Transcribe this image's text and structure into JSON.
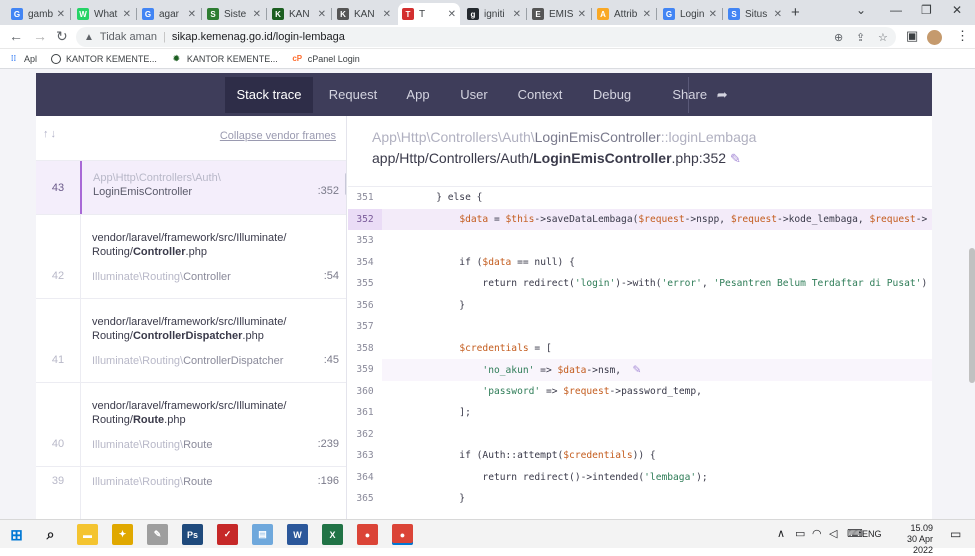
{
  "browser": {
    "tabs": [
      {
        "label": "gamb",
        "color": "#4285f4",
        "glyph": "G"
      },
      {
        "label": "What",
        "color": "#25d366",
        "glyph": "W"
      },
      {
        "label": "agar",
        "color": "#4285f4",
        "glyph": "G"
      },
      {
        "label": "Siste",
        "color": "#2e7d32",
        "glyph": "S"
      },
      {
        "label": "KAN",
        "color": "#1b5e20",
        "glyph": "K"
      },
      {
        "label": "KAN",
        "color": "#555555",
        "glyph": "K"
      },
      {
        "label": "T",
        "color": "#d32f2f",
        "glyph": "T"
      },
      {
        "label": "igniti",
        "color": "#24292e",
        "glyph": "g"
      },
      {
        "label": "EMIS",
        "color": "#555555",
        "glyph": "E"
      },
      {
        "label": "Attrib",
        "color": "#f9a825",
        "glyph": "A"
      },
      {
        "label": "Login",
        "color": "#4285f4",
        "glyph": "G"
      },
      {
        "label": "Situs",
        "color": "#4285f4",
        "glyph": "S"
      }
    ],
    "security_label": "Tidak aman",
    "url": "sikap.kemenag.go.id/login-lembaga",
    "bookmarks": [
      "Apl",
      "KANTOR KEMENTE...",
      "KANTOR KEMENTE...",
      "cPanel Login"
    ]
  },
  "ignition": {
    "tabs": [
      "Stack trace",
      "Request",
      "App",
      "User",
      "Context",
      "Debug",
      "Share"
    ],
    "active_tab": "Stack trace",
    "collapse_label": "Collapse vendor frames",
    "frames": [
      {
        "number": "43",
        "ns": "App\\Http\\Controllers\\Auth\\",
        "cls": "LoginEmisController",
        "line": ":352"
      },
      {
        "number": "42",
        "path_pre": "vendor/laravel/framework/src/Illuminate/",
        "path_mid": "Routing/",
        "path_bold": "Controller",
        "path_ext": ".php",
        "ns": "Illuminate\\Routing\\",
        "cls": "Controller",
        "line": ":54"
      },
      {
        "number": "41",
        "path_pre": "vendor/laravel/framework/src/Illuminate/",
        "path_mid": "Routing/",
        "path_bold": "ControllerDispatcher",
        "path_ext": ".php",
        "ns": "Illuminate\\Routing\\",
        "cls": "ControllerDispatcher",
        "line": ":45"
      },
      {
        "number": "40",
        "path_pre": "vendor/laravel/framework/src/Illuminate/",
        "path_mid": "Routing/",
        "path_bold": "Route",
        "path_ext": ".php",
        "ns": "Illuminate\\Routing\\",
        "cls": "Route",
        "line": ":239"
      },
      {
        "number": "39",
        "ns": "Illuminate\\Routing\\",
        "cls": "Route",
        "line": ":196"
      }
    ],
    "source": {
      "class_ns": "App\\Http\\Controllers\\Auth\\",
      "class_name": "LoginEmisController",
      "method": "::loginLembaga",
      "file_prefix": "app/Http/Controllers/Auth/",
      "file_bold": "LoginEmisController",
      "file_suffix": ".php:352"
    },
    "code": [
      {
        "n": "351",
        "segs": [
          [
            "k",
            "        } else {"
          ]
        ]
      },
      {
        "n": "352",
        "segs": [
          [
            "k",
            "            "
          ],
          [
            "v",
            "$data"
          ],
          [
            "k",
            " = "
          ],
          [
            "v",
            "$this"
          ],
          [
            "k",
            "->saveDataLembaga("
          ],
          [
            "v",
            "$request"
          ],
          [
            "k",
            "->nspp, "
          ],
          [
            "v",
            "$request"
          ],
          [
            "k",
            "->kode_lembaga, "
          ],
          [
            "v",
            "$request"
          ],
          [
            "k",
            "->"
          ]
        ]
      },
      {
        "n": "353",
        "segs": [
          [
            "k",
            ""
          ]
        ]
      },
      {
        "n": "354",
        "segs": [
          [
            "k",
            "            if ("
          ],
          [
            "v",
            "$data"
          ],
          [
            "k",
            " == null) {"
          ]
        ]
      },
      {
        "n": "355",
        "segs": [
          [
            "k",
            "                return redirect("
          ],
          [
            "s",
            "'login'"
          ],
          [
            "k",
            ")->with("
          ],
          [
            "s",
            "'error'"
          ],
          [
            "k",
            ", "
          ],
          [
            "s",
            "'Pesantren Belum Terdaftar di Pusat'"
          ],
          [
            "k",
            ")"
          ]
        ]
      },
      {
        "n": "356",
        "segs": [
          [
            "k",
            "            }"
          ]
        ]
      },
      {
        "n": "357",
        "segs": [
          [
            "k",
            ""
          ]
        ]
      },
      {
        "n": "358",
        "segs": [
          [
            "k",
            "            "
          ],
          [
            "v",
            "$credentials"
          ],
          [
            "k",
            " = ["
          ]
        ]
      },
      {
        "n": "359",
        "segs": [
          [
            "k",
            "                "
          ],
          [
            "s",
            "'no_akun'"
          ],
          [
            "k",
            " => "
          ],
          [
            "v",
            "$data"
          ],
          [
            "k",
            "->nsm,"
          ]
        ]
      },
      {
        "n": "360",
        "segs": [
          [
            "k",
            "                "
          ],
          [
            "s",
            "'password'"
          ],
          [
            "k",
            " => "
          ],
          [
            "v",
            "$request"
          ],
          [
            "k",
            "->password_temp,"
          ]
        ]
      },
      {
        "n": "361",
        "segs": [
          [
            "k",
            "            ];"
          ]
        ]
      },
      {
        "n": "362",
        "segs": [
          [
            "k",
            ""
          ]
        ]
      },
      {
        "n": "363",
        "segs": [
          [
            "k",
            "            if (Auth::attempt("
          ],
          [
            "v",
            "$credentials"
          ],
          [
            "k",
            ")) {"
          ]
        ]
      },
      {
        "n": "364",
        "segs": [
          [
            "k",
            "                return redirect()->intended("
          ],
          [
            "s",
            "'lembaga'"
          ],
          [
            "k",
            ");"
          ]
        ]
      },
      {
        "n": "365",
        "segs": [
          [
            "k",
            "            }"
          ]
        ]
      }
    ]
  },
  "taskbar": {
    "apps": [
      {
        "name": "file-explorer-icon",
        "color": "#f4c430",
        "glyph": "▬"
      },
      {
        "name": "app-icon-1",
        "color": "#e0a800",
        "glyph": "✦"
      },
      {
        "name": "app-icon-2",
        "color": "#9e9e9e",
        "glyph": "✎"
      },
      {
        "name": "photoshop-icon",
        "color": "#1f4a7c",
        "glyph": "Ps"
      },
      {
        "name": "app-icon-3",
        "color": "#c62828",
        "glyph": "✓"
      },
      {
        "name": "app-icon-4",
        "color": "#6fa8dc",
        "glyph": "▤"
      },
      {
        "name": "word-icon",
        "color": "#2b579a",
        "glyph": "W"
      },
      {
        "name": "excel-icon",
        "color": "#217346",
        "glyph": "X"
      },
      {
        "name": "chrome-icon",
        "color": "#db4437",
        "glyph": "●"
      },
      {
        "name": "chrome-icon-2",
        "color": "#db4437",
        "glyph": "●"
      }
    ],
    "lang": "ENG",
    "time": "15.09",
    "date": "30 Apr 2022"
  }
}
